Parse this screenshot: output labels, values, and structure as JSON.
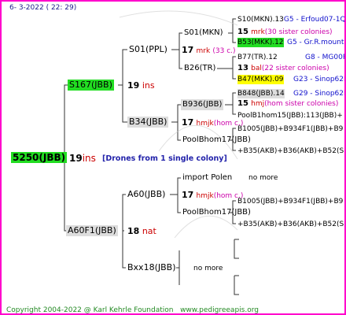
{
  "header": {
    "date": "6-  3-2022 ( 22: 29)"
  },
  "root": {
    "name": "5250(JBB)",
    "count": "19",
    "unit": "ins",
    "note": "[Drones from 1 single colony]"
  },
  "gen1": {
    "top": {
      "name": "S167(JBB)",
      "count": "19",
      "unit": "ins"
    },
    "bottom": {
      "name": "A60F1(JBB)",
      "count": "18",
      "unit": "nat"
    }
  },
  "gen2": {
    "s01": {
      "name": "S01(PPL)",
      "count": "17",
      "unit": "mrk",
      "note": "(33 c.)"
    },
    "b34": {
      "name": "B34(JBB)",
      "count": "17",
      "unit": "hmjk",
      "note": "(hom c.)"
    },
    "a60": {
      "name": "A60(JBB)",
      "count": "17",
      "unit": "hmjk",
      "note": "(hom c.)"
    },
    "bxx18": {
      "name": "Bxx18(JBB)",
      "none": "no more"
    }
  },
  "gen3": {
    "s01mkn": {
      "name": "S01(MKN)",
      "count": "15",
      "unit": "mrk",
      "note": "(30 sister colonies)"
    },
    "b26": {
      "name": "B26(TR)",
      "count": "13",
      "unit": "bal",
      "note": "(22 sister colonies)"
    },
    "b936": {
      "name": "B936(JBB)",
      "count": "15",
      "unit": "hmj",
      "note": "(hom sister colonies)"
    },
    "poolbhom_a": {
      "name": "PoolBhom17(JBB)"
    },
    "import": {
      "name": "import Polen",
      "none": "no more"
    },
    "poolbhom_b": {
      "name": "PoolBhom17(JBB)"
    }
  },
  "gen4": {
    "r1": {
      "name": "S10(MKN).13",
      "extra": "G5 - Erfoud07-1Q"
    },
    "r2": {
      "name": "B53(MKK).12",
      "extra": "G5 - Gr.R.mounta"
    },
    "r3": {
      "name": "B77(TR).12",
      "extra": "G8 - MG00R"
    },
    "r4": {
      "name": "B47(MKK).09",
      "extra": "G23 - Sinop62R"
    },
    "r5": {
      "name": "B848(JBB).14",
      "extra": "G29 - Sinop62R"
    },
    "r6": {
      "name": "PoolB1hom15(JBB):113(JBB)+",
      "extra": ""
    },
    "r7": {
      "name": "B1005(JBB)+B934F1(JBB)+B9",
      "extra": ""
    },
    "r8": {
      "name": "+B35(AKB)+B36(AKB)+B52(S",
      "extra": ""
    },
    "r9": {
      "name": "B1005(JBB)+B934F1(JBB)+B9",
      "extra": ""
    },
    "r10": {
      "name": "+B35(AKB)+B36(AKB)+B52(S",
      "extra": ""
    }
  },
  "footer": {
    "copyright": "Copyright 2004-2022 @ Karl Kehrle Foundation",
    "url": "www.pedigreeapis.org"
  }
}
